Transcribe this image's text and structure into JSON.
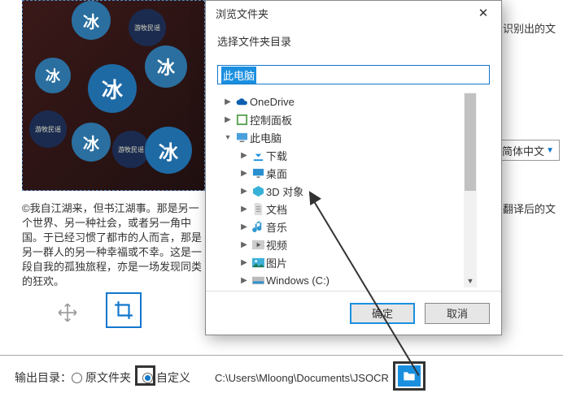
{
  "caption": "©我自江湖来，但书江湖事。那是另一个世界、另一种社会，或者另一角中国。于已经习惯了都市的人而言，那是另一群人的另一种幸福或不幸。这是一段自我的孤独旅程，亦是一场发现同类的狂欢。",
  "right": {
    "t1": "识别出的文",
    "t2": "翻译后的文"
  },
  "lang_selected": "简体中文",
  "dialog": {
    "title": "浏览文件夹",
    "subtitle": "选择文件夹目录",
    "input_value": "此电脑",
    "ok": "确定",
    "cancel": "取消"
  },
  "tree": {
    "onedrive": "OneDrive",
    "control": "控制面板",
    "thispc": "此电脑",
    "downloads": "下载",
    "desktop": "桌面",
    "objects3d": "3D 对象",
    "documents": "文档",
    "music": "音乐",
    "videos": "视频",
    "pictures": "图片",
    "drivec": "Windows (C:)"
  },
  "output": {
    "label": "输出目录：",
    "original": "原文件夹",
    "custom": "自定义",
    "path": "C:\\Users\\Mloong\\Documents\\JSOCR"
  }
}
